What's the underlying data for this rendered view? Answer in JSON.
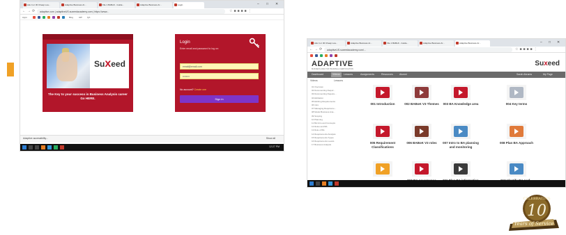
{
  "orange_marker_color": "#f0a126",
  "left_shot": {
    "tabs": [
      {
        "label": "Ask 4 or 30 Cheap Loa..."
      },
      {
        "label": "Adaptive Business Ar..."
      },
      {
        "label": "File 1 BABoK - Guide..."
      },
      {
        "label": "Adaptive Business Ar..."
      },
      {
        "label": "Login",
        "active": true
      }
    ],
    "url": "adaptive.com  |  adaptiveUS.suxeedacademy.com  |  https://www...",
    "bookmarks": [
      "Apps",
      "Blog",
      "AW",
      "QA"
    ],
    "brand": {
      "logo_prefix": "Su",
      "logo_x": "x",
      "logo_suffix": "eed",
      "tagline": "The Key to your success in Business Analysis career Go HERE."
    },
    "login": {
      "title": "Login",
      "subtitle": "Enter email and password to log on:",
      "email_value": "email@email.com",
      "password_value": "••••••••",
      "forgot_text": "No account?",
      "forgot_link": "Create one",
      "signin_label": "Sign in"
    },
    "download": {
      "item": "Adaptive accessibility...",
      "show_all": "Show all"
    },
    "clock": "12:27 PM"
  },
  "right_shot": {
    "tabs": [
      {
        "label": "Ask 4 or 30 Cheap Loa..."
      },
      {
        "label": "Adaptive Business Ar..."
      },
      {
        "label": "File 1 BABoK - Guide..."
      },
      {
        "label": "Adaptive Business Ar..."
      },
      {
        "label": "Adaptive Business Ar...",
        "active": true
      }
    ],
    "url": "adaptiveUS.suxeedacademy.com/...",
    "brand": {
      "adaptive": "ADAPTIVE",
      "adaptive_sub": "BUSINESS ANALYSIS TRAINING & CERTIFICATION",
      "suxeed_prefix": "Su",
      "suxeed_x": "x",
      "suxeed_suffix": "eed"
    },
    "menu": [
      "Dashboard",
      "Videos",
      "Lessons",
      "Assignments",
      "Resources",
      "Alumni"
    ],
    "menu_right": [
      "Sarah Abrams",
      "My Page"
    ],
    "sidebar_tabs": [
      "Videos",
      "Lessons"
    ],
    "sidebar_items": [
      "01 Overview",
      "02 Documenting Requir...",
      "03 Documenting Require...",
      "04 Elicitation",
      "05 Eliciting Requirements",
      "06 Intro",
      "07 Managing Requireme...",
      "08 Model Business Ana...",
      "09 Scoping",
      "10 Planning",
      "11 BA Intro and Concepts",
      "12 Roles and BA",
      "13 Role of BA",
      "14 Requirements Analysis",
      "15 Requirements Types",
      "16 Requirements Levels",
      "17 Business Analysis"
    ],
    "tiles": [
      {
        "caption": "001 Introduction",
        "color": "#c4182b"
      },
      {
        "caption": "002 BABoK V3 Themes",
        "color": "#8e3a3a"
      },
      {
        "caption": "003 BA Knowledge area",
        "color": "#c4182b"
      },
      {
        "caption": "004 Key terms",
        "color": "#b0b8c4"
      },
      {
        "caption": "005 Requirement Classifications",
        "color": "#c4182b"
      },
      {
        "caption": "006 BABoK V3 roles",
        "color": "#7a3a2a"
      },
      {
        "caption": "007 Intro to BA planning and monitoring",
        "color": "#4a8ac4"
      },
      {
        "caption": "008 Plan BA Approach",
        "color": "#e07a3a"
      },
      {
        "caption": "",
        "color": "#f0a126"
      },
      {
        "caption": "010 BA governance",
        "color": "#c4182b"
      },
      {
        "caption": "011 Plan BA information",
        "color": "#3a3a3a"
      },
      {
        "caption": "012 Identify BA perf...",
        "color": "#4a8ac4"
      }
    ]
  },
  "badge": {
    "top": "CELEBRATING",
    "number": "10",
    "bottom": "Years of Service",
    "color": "#6a4a1a"
  }
}
